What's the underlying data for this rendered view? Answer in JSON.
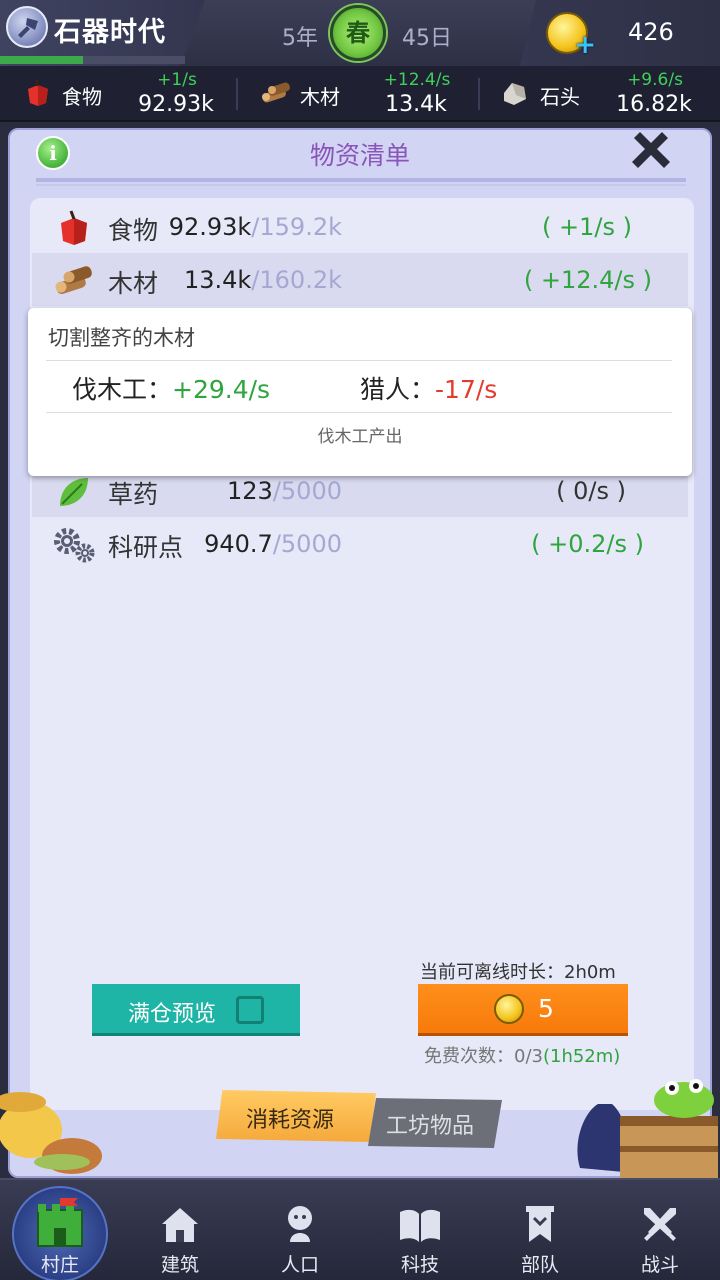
{
  "header": {
    "era_title": "石器时代",
    "era_progress": 0.45,
    "year": "5年",
    "season": "春",
    "day": "45日",
    "gems": "426"
  },
  "resource_bar": [
    {
      "name": "食物",
      "rate": "+1/s",
      "amount": "92.93k",
      "icon": "apple-icon"
    },
    {
      "name": "木材",
      "rate": "+12.4/s",
      "amount": "13.4k",
      "icon": "wood-icon"
    },
    {
      "name": "石头",
      "rate": "+9.6/s",
      "amount": "16.82k",
      "icon": "stone-icon"
    }
  ],
  "panel": {
    "title": "物资清单",
    "info_label": "i",
    "rows": [
      {
        "name": "食物",
        "current": "92.93k",
        "max": "/159.2k",
        "rate": "( +1/s )"
      },
      {
        "name": "木材",
        "current": "13.4k",
        "max": "/160.2k",
        "rate": "( +12.4/s )"
      },
      {
        "name": "草药",
        "current": "123",
        "max": "/5000",
        "rate": "( 0/s )"
      },
      {
        "name": "科研点",
        "current": "940.7",
        "max": "/5000",
        "rate": "( +0.2/s )"
      }
    ],
    "tooltip": {
      "title": "切割整齐的木材",
      "items": [
        {
          "label": "伐木工：",
          "value": "+29.4/s"
        },
        {
          "label": "猎人：",
          "value": "-17/s"
        }
      ],
      "footer": "伐木工产出"
    },
    "full_preview_label": "满仓预览",
    "offline_label": "当前可离线时长：2h0m",
    "speed_cost": "5",
    "free_times_prefix": "免费次数：0/3",
    "free_times_timer": "(1h52m)",
    "tabs": {
      "consume": "消耗资源",
      "workshop": "工坊物品"
    }
  },
  "nav": [
    {
      "label": "村庄",
      "icon": "castle-icon"
    },
    {
      "label": "建筑",
      "icon": "house-icon"
    },
    {
      "label": "人口",
      "icon": "person-icon"
    },
    {
      "label": "科技",
      "icon": "book-icon"
    },
    {
      "label": "部队",
      "icon": "banner-icon"
    },
    {
      "label": "战斗",
      "icon": "swords-icon"
    }
  ],
  "colors": {
    "positive": "#2fa43f",
    "negative": "#e43b2e",
    "accent_orange": "#f77a0a",
    "accent_teal": "#1eb5a6",
    "panel_title": "#8a55b9"
  }
}
